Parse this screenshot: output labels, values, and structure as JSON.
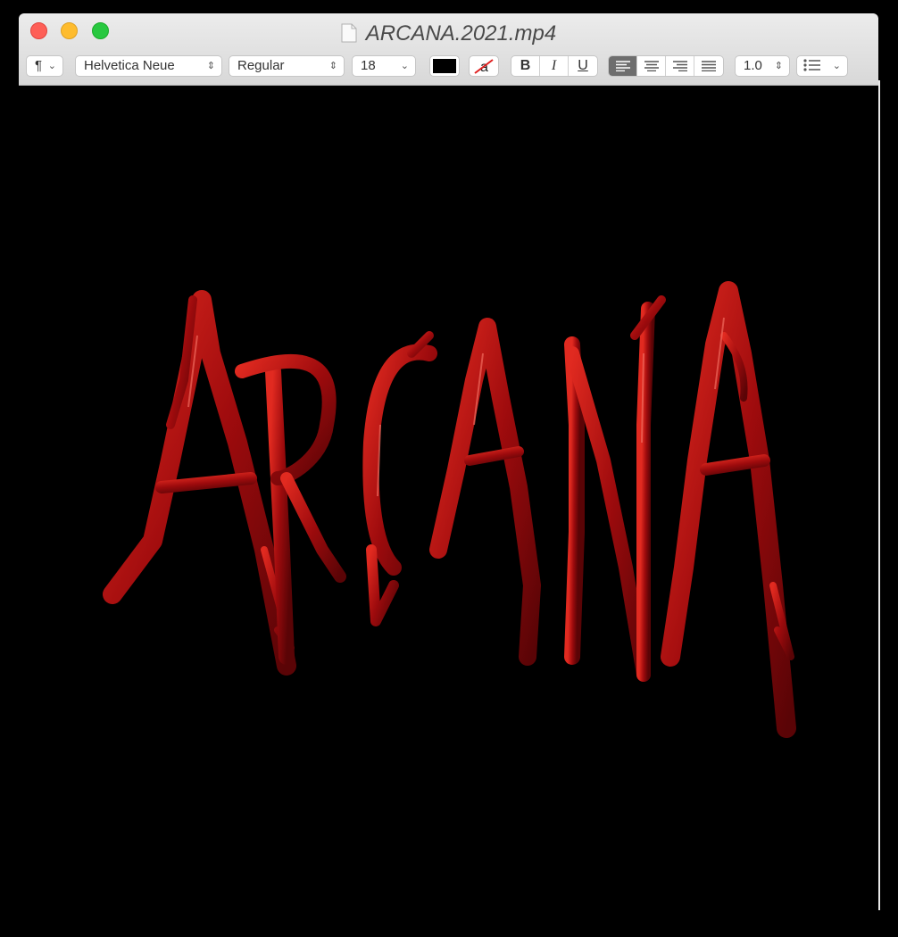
{
  "window": {
    "title": "ARCANA.2021.mp4"
  },
  "toolbar": {
    "paragraph_style": "¶",
    "font_family": "Helvetica Neue",
    "font_style": "Regular",
    "font_size": "18",
    "text_color": "#000000",
    "bold": "B",
    "italic": "I",
    "underline": "U",
    "line_spacing": "1.0",
    "alignment_selected": "left"
  },
  "content": {
    "artwork_text": "ARCANA",
    "artwork_color": "#b30f10",
    "background": "#000000"
  }
}
